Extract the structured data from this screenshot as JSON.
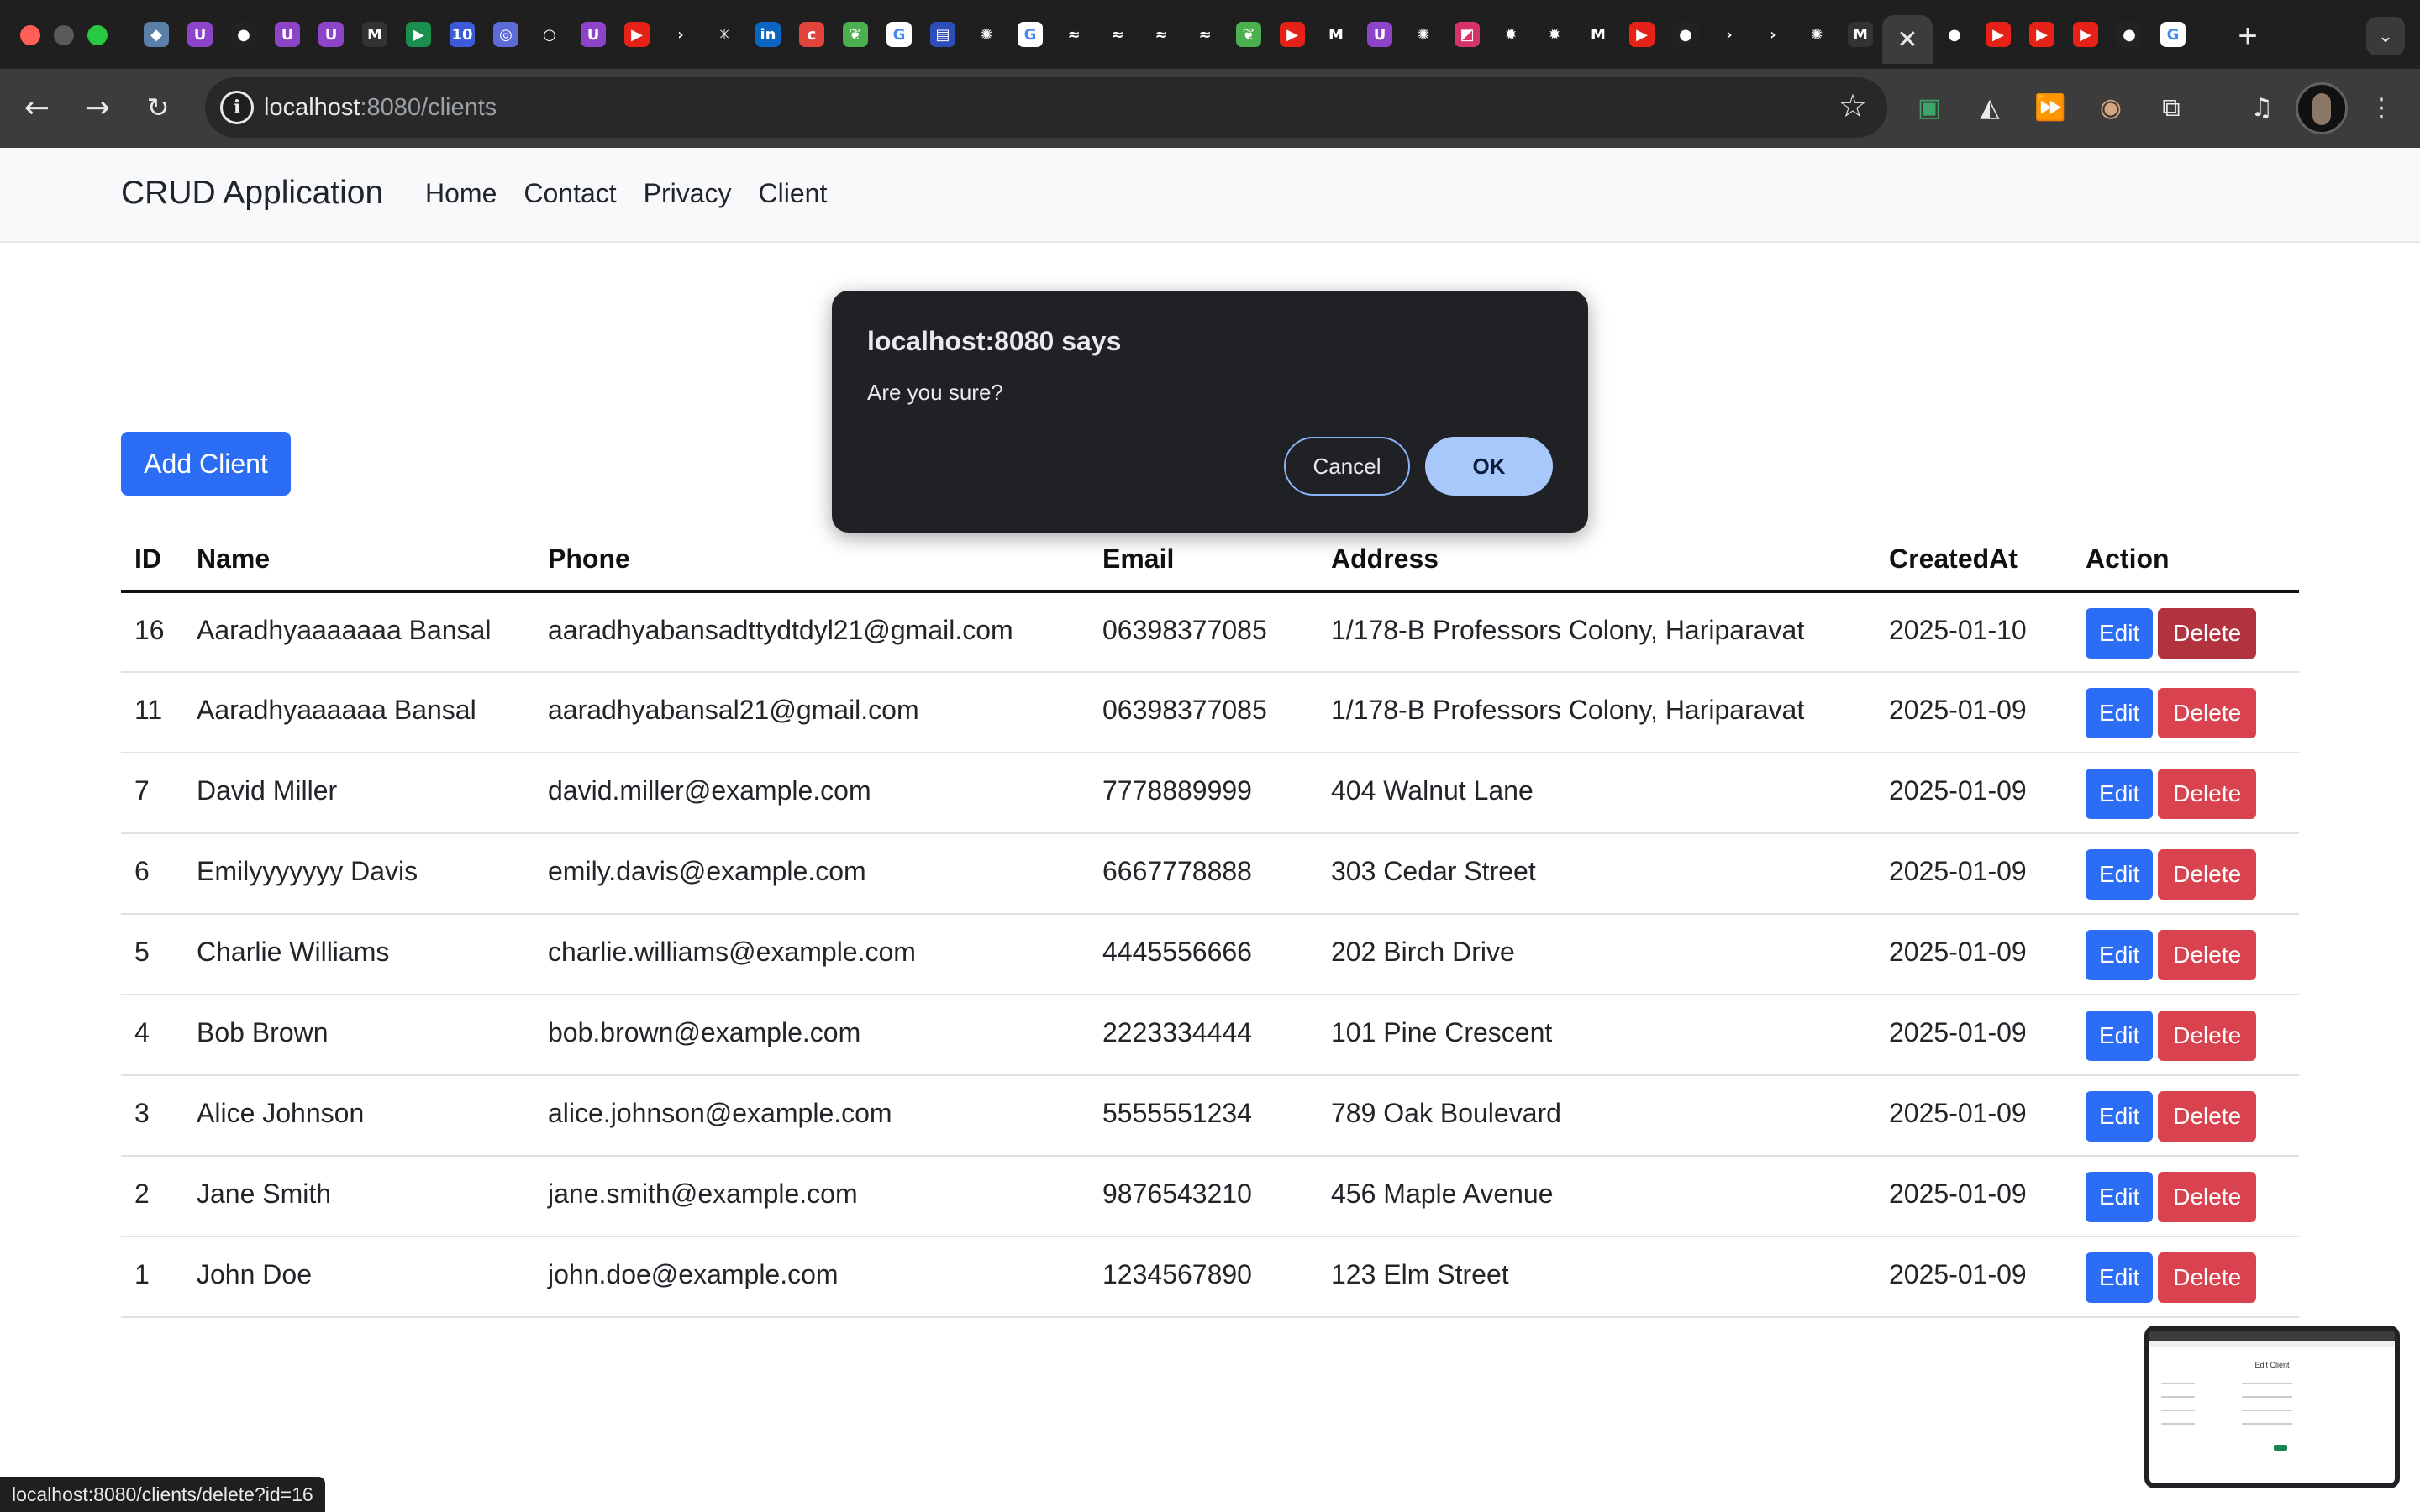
{
  "browser": {
    "address": {
      "host": "localhost",
      "path": ":8080/clients"
    },
    "close_tab_glyph": "✕",
    "new_tab_glyph": "+",
    "status_url": "localhost:8080/clients/delete?id=16"
  },
  "navbar": {
    "brand": "CRUD Application",
    "links": [
      "Home",
      "Contact",
      "Privacy",
      "Client"
    ]
  },
  "page": {
    "add_button": "Add Client"
  },
  "table": {
    "headers": [
      "ID",
      "Name",
      "Phone",
      "Email",
      "Address",
      "CreatedAt",
      "Action"
    ],
    "edit_label": "Edit",
    "delete_label": "Delete",
    "rows": [
      [
        "16",
        "Aaradhyaaaaaaa Bansal",
        "aaradhyabansadttydtdyl21@gmail.com",
        "06398377085",
        "1/178-B Professors Colony, Hariparavat",
        "2025-01-10"
      ],
      [
        "11",
        "Aaradhyaaaaaa Bansal",
        "aaradhyabansal21@gmail.com",
        "06398377085",
        "1/178-B Professors Colony, Hariparavat",
        "2025-01-09"
      ],
      [
        "7",
        "David Miller",
        "david.miller@example.com",
        "7778889999",
        "404 Walnut Lane",
        "2025-01-09"
      ],
      [
        "6",
        "Emilyyyyyyy Davis",
        "emily.davis@example.com",
        "6667778888",
        "303 Cedar Street",
        "2025-01-09"
      ],
      [
        "5",
        "Charlie Williams",
        "charlie.williams@example.com",
        "4445556666",
        "202 Birch Drive",
        "2025-01-09"
      ],
      [
        "4",
        "Bob Brown",
        "bob.brown@example.com",
        "2223334444",
        "101 Pine Crescent",
        "2025-01-09"
      ],
      [
        "3",
        "Alice Johnson",
        "alice.johnson@example.com",
        "5555551234",
        "789 Oak Boulevard",
        "2025-01-09"
      ],
      [
        "2",
        "Jane Smith",
        "jane.smith@example.com",
        "9876543210",
        "456 Maple Avenue",
        "2025-01-09"
      ],
      [
        "1",
        "John Doe",
        "john.doe@example.com",
        "1234567890",
        "123 Elm Street",
        "2025-01-09"
      ]
    ]
  },
  "dialog": {
    "title": "localhost:8080 says",
    "message": "Are you sure?",
    "cancel": "Cancel",
    "ok": "OK"
  },
  "pip": {
    "title": "Edit Client"
  },
  "colors": {
    "primary": "#2b6df5",
    "danger": "#d9434f",
    "danger_hover": "#b1333d",
    "dialog_bg": "#202124",
    "ok_button": "#a8c7fa"
  },
  "icons": {
    "back": "back-arrow-icon",
    "forward": "forward-arrow-icon",
    "reload": "reload-icon",
    "site_info": "info-icon",
    "bookmark": "star-icon",
    "extensions": "puzzle-icon",
    "menu": "kebab-menu-icon"
  }
}
